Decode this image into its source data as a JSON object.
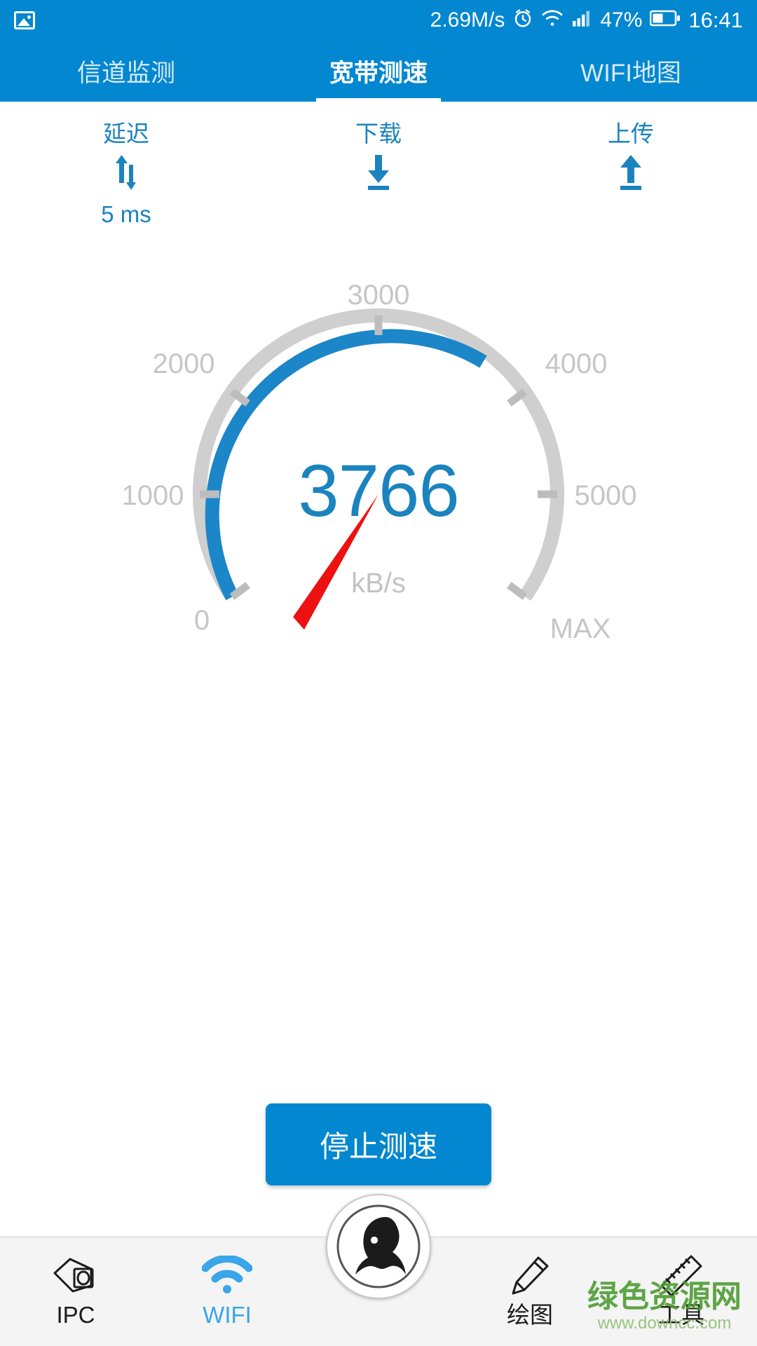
{
  "statusbar": {
    "gallery_icon": "image-icon",
    "net_speed": "2.69M/s",
    "alarm_icon": "alarm-icon",
    "wifi_icon": "wifi-icon",
    "signal_icon": "signal-bars-icon",
    "battery_percent": "47%",
    "battery_icon": "battery-icon",
    "time": "16:41"
  },
  "tabs": [
    {
      "label": "信道监测",
      "active": false
    },
    {
      "label": "宽带测速",
      "active": true
    },
    {
      "label": "WIFI地图",
      "active": false
    }
  ],
  "metrics": [
    {
      "label": "延迟",
      "icon": "up-down-arrows-icon",
      "value": "5 ms"
    },
    {
      "label": "下载",
      "icon": "download-arrow-icon",
      "value": ""
    },
    {
      "label": "上传",
      "icon": "upload-arrow-icon",
      "value": ""
    }
  ],
  "gauge": {
    "reading": "3766",
    "unit": "kB/s",
    "needle_icon": "gauge-needle-icon"
  },
  "chart_data": {
    "type": "gauge",
    "title": "宽带测速",
    "value": 3766,
    "unit": "kB/s",
    "min": 0,
    "max": 6000,
    "tick_labels": [
      "0",
      "1000",
      "2000",
      "3000",
      "4000",
      "5000",
      "MAX"
    ],
    "tick_values": [
      0,
      1000,
      2000,
      3000,
      4000,
      5000,
      6000
    ],
    "filled_color": "#1b86c8",
    "track_color": "#cfcfcf",
    "needle_color": "#ee1111",
    "label_color": "#c6c6c6",
    "value_color": "#1b83bd",
    "start_angle_deg": 145,
    "sweep_deg": 250
  },
  "action_button": {
    "label": "停止测速"
  },
  "bottom_nav": [
    {
      "label": "IPC",
      "icon": "camera-icon",
      "active": false
    },
    {
      "label": "WIFI",
      "icon": "wifi-icon",
      "active": true
    },
    {
      "label": "",
      "icon": "lion-logo-icon",
      "active": false
    },
    {
      "label": "绘图",
      "icon": "pencil-icon",
      "active": false
    },
    {
      "label": "工具",
      "icon": "ruler-icon",
      "active": false
    }
  ],
  "watermark": {
    "main": "绿色资源网",
    "sub": "www.downcc.com"
  },
  "colors": {
    "brand_blue": "#0287d0",
    "gauge_blue": "#1b86c8",
    "gauge_gray": "#cfcfcf",
    "needle_red": "#ee1111",
    "nav_active": "#3aa5e8"
  }
}
